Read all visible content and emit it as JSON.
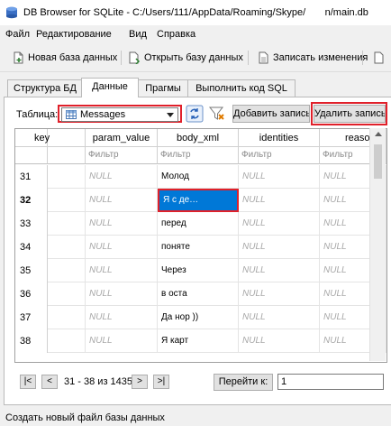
{
  "window": {
    "title": "DB Browser for SQLite - C:/Users/111/AppData/Roaming/Skype/       n/main.db"
  },
  "menu": [
    "Файл",
    "Редактирование",
    "Вид",
    "Справка"
  ],
  "toolbar": {
    "new_db": "Новая база данных",
    "open_db": "Открыть базу данных",
    "write_changes": "Записать изменения"
  },
  "tabs": [
    "Структура БД",
    "Данные",
    "Прагмы",
    "Выполнить код SQL"
  ],
  "active_tab": "Данные",
  "table_selector": {
    "label": "Таблица:",
    "value": "Messages"
  },
  "buttons": {
    "add_record": "Добавить запись",
    "delete_record": "Удалить запись"
  },
  "grid": {
    "columns": [
      "key",
      "param_value",
      "body_xml",
      "identities",
      "reason"
    ],
    "filter_placeholder": "Фильтр",
    "rows": [
      {
        "num": "31",
        "key": "",
        "param_value": "NULL",
        "body_xml": "Молод",
        "identities": "NULL",
        "reason": "NULL"
      },
      {
        "num": "32",
        "key": "",
        "param_value": "NULL",
        "body_xml": "Я с де…",
        "identities": "NULL",
        "reason": "NULL"
      },
      {
        "num": "33",
        "key": "",
        "param_value": "NULL",
        "body_xml": "перед",
        "identities": "NULL",
        "reason": "NULL"
      },
      {
        "num": "34",
        "key": "",
        "param_value": "NULL",
        "body_xml": "поняте",
        "identities": "NULL",
        "reason": "NULL"
      },
      {
        "num": "35",
        "key": "",
        "param_value": "NULL",
        "body_xml": "Через",
        "identities": "NULL",
        "reason": "NULL"
      },
      {
        "num": "36",
        "key": "",
        "param_value": "NULL",
        "body_xml": "в оста",
        "identities": "NULL",
        "reason": "NULL"
      },
      {
        "num": "37",
        "key": "",
        "param_value": "NULL",
        "body_xml": "Да нор             ))",
        "identities": "NULL",
        "reason": "NULL"
      },
      {
        "num": "38",
        "key": "",
        "param_value": "NULL",
        "body_xml": "Я карт",
        "identities": "NULL",
        "reason": "NULL"
      }
    ],
    "selected_row": "32"
  },
  "pager": {
    "first": "|<",
    "prev": "<",
    "range": "31 - 38 из 1435",
    "next": ">",
    "last": ">|",
    "goto_label": "Перейти к:",
    "goto_value": "1"
  },
  "status": "Создать новый файл базы данных",
  "colors": {
    "highlight_red": "#e0202a",
    "selection_blue": "#0078d7",
    "null_gray": "#a8a8a8"
  }
}
